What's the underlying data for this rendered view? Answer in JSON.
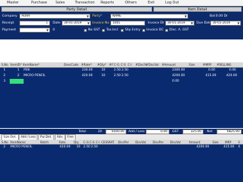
{
  "menu": {
    "items": [
      "Master",
      "Purchase",
      "Sales",
      "Transaction",
      "Reports",
      "Others",
      "Exit",
      "Log Out"
    ]
  },
  "headers": {
    "party_detail": "Party Detail",
    "item_detail": "Item Detail"
  },
  "form": {
    "company_label": "Company",
    "company_value": "AURA",
    "party_label": "Party*",
    "party_value": "NAME",
    "bal_label": "Bal:0.00 Dr",
    "receipt_label": "Receipt",
    "receipt_value": "1",
    "date_label": "Date",
    "date_value": "30-01-2019",
    "invoice_no_label": "Invoice No",
    "invoice_no_value": "1001",
    "invoice_dt_label": "Invoice Dt",
    "invoice_dt_value": "30-01-2019",
    "due_date_label": "Due Date",
    "due_date_value": "30-01-2019",
    "payment_label": "Payment",
    "no_gst_label": "No GST",
    "tax_incl_label": "Tax.Incl",
    "slip_entry_label": "Slip Entry",
    "invoice_dc_label": "Invoice DC",
    "disc_gst_label": "Disc. A. GST"
  },
  "grid": {
    "columns": [
      "S.No",
      "ItemID*",
      "ItemName*",
      "DescCode",
      "#Rate*",
      "#Qty*",
      "#F",
      "C-G",
      "C-S",
      "C-I",
      "#Disc%",
      "#DiscVal",
      "#Amount",
      "Size",
      "#MRP",
      "#SELLING"
    ],
    "rows": [
      {
        "sno": "1",
        "itemid": "1",
        "name": "PEN",
        "rate": "230.00",
        "qty": "10",
        "f": "",
        "cg": "2.50",
        "cs": "2.50",
        "amount": "2300.00",
        "size": "",
        "mrp": "0.00",
        "selling": "0.00"
      },
      {
        "sno": "2",
        "itemid": "2",
        "name": "MICRO PENCIL",
        "rate": "420.00",
        "qty": "10",
        "f": "",
        "cg": "2.50",
        "cs": "2.50",
        "amount": "4200.00",
        "size": "",
        "mrp": "415.00",
        "selling": "420.00"
      },
      {
        "sno": "3",
        "itemid": "",
        "name": "",
        "rate": "",
        "qty": "",
        "f": "",
        "cg": "",
        "cs": "",
        "amount": "0.00",
        "size": "",
        "mrp": "",
        "selling": ""
      }
    ]
  },
  "totals": {
    "total_label": "Total",
    "qty": "20",
    "amount": "6500.00",
    "add_less_label": "Add / Less",
    "add_less_value": "0.00",
    "gst_label": "GST",
    "gst_value": "325.00",
    "net_label": "Net",
    "net_value": "6825.00"
  },
  "tabs": [
    "Size Det.",
    "Add / Less",
    "Pur.Det.",
    "Adv.",
    "Free"
  ],
  "sub": {
    "columns": [
      "S.No",
      "ItemName",
      "Batch",
      "Rate",
      "Qty",
      "C-G",
      "C-S",
      "C-I",
      "CESSRAT",
      "DiscPer",
      "DiscVal",
      "DiscPer",
      "DiscVal",
      "Amount",
      "Size",
      "MRP",
      "S"
    ],
    "rows": [
      {
        "sno": "2",
        "name": "MICRO PENCIL",
        "rate": "420.00",
        "qty": "10",
        "cg": "2.50",
        "cs": "2.50",
        "amount": "4200.00",
        "mrp": "415.00",
        "s": "4"
      }
    ]
  }
}
